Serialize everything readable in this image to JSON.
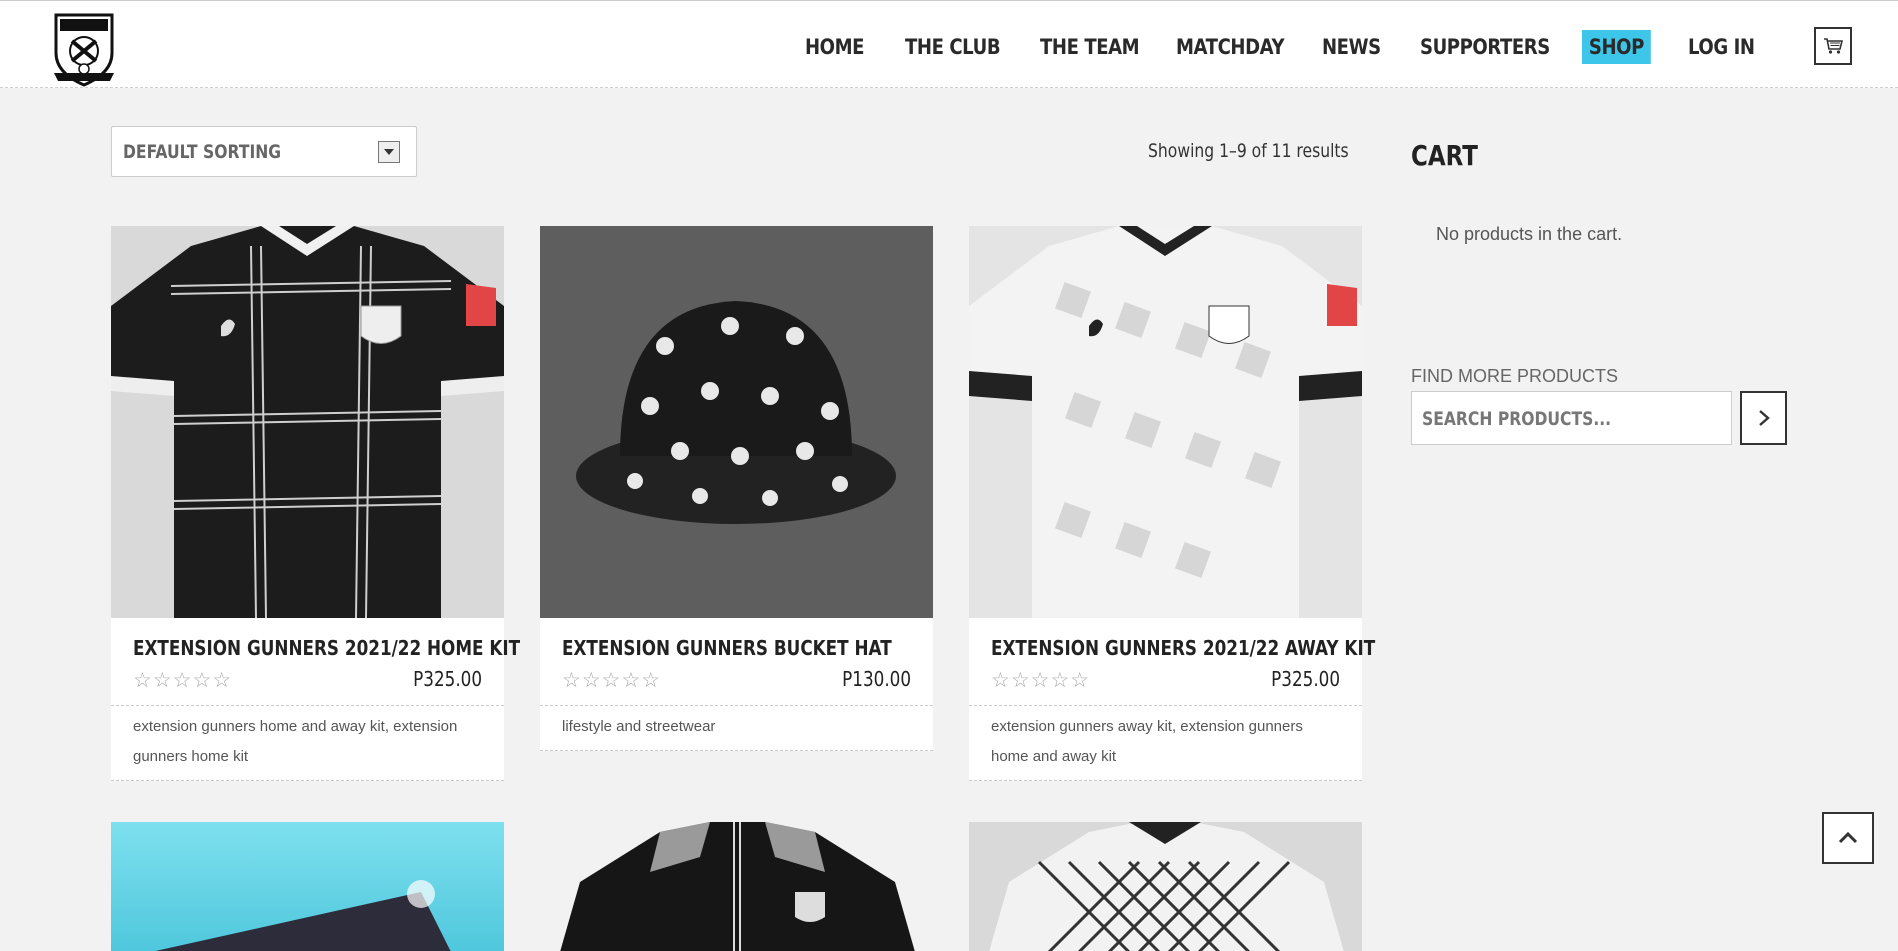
{
  "brand": {
    "logo_alt": "Extension Gunners crest"
  },
  "nav": {
    "items": [
      {
        "label": "HOME"
      },
      {
        "label": "THE CLUB"
      },
      {
        "label": "THE TEAM"
      },
      {
        "label": "MATCHDAY"
      },
      {
        "label": "NEWS"
      },
      {
        "label": "SUPPORTERS"
      },
      {
        "label": "SHOP",
        "active": true
      },
      {
        "label": "LOG IN"
      }
    ],
    "cart_icon": "cart-icon",
    "active_color": "#3ec6ea"
  },
  "shop": {
    "sorting": {
      "selected": "DEFAULT SORTING"
    },
    "result_count": "Showing 1–9 of 11 results",
    "products": [
      {
        "title": "EXTENSION GUNNERS 2021/22 HOME KIT",
        "price": "P325.00",
        "rating": 0,
        "tags": [
          "extension gunners home and away kit",
          "extension gunners home kit"
        ],
        "tags_sep": ",",
        "tags_text": "extension gunners home and away kit, extension gunners home kit"
      },
      {
        "title": "EXTENSION GUNNERS BUCKET HAT",
        "price": "P130.00",
        "rating": 0,
        "tags": [
          "lifestyle and streetwear"
        ],
        "tags_text": "lifestyle and streetwear"
      },
      {
        "title": "EXTENSION GUNNERS 2021/22 AWAY KIT",
        "price": "P325.00",
        "rating": 0,
        "tags": [
          "extension gunners away kit",
          "extension gunners home and away kit"
        ],
        "tags_text": "extension gunners away kit, extension gunners home and away kit"
      }
    ]
  },
  "sidebar": {
    "cart_title": "CART",
    "cart_empty": "No products in the cart.",
    "find_label": "FIND MORE PRODUCTS",
    "search_placeholder": "SEARCH PRODUCTS..."
  },
  "colors": {
    "background": "#f2f2f2",
    "accent": "#3ec6ea"
  }
}
